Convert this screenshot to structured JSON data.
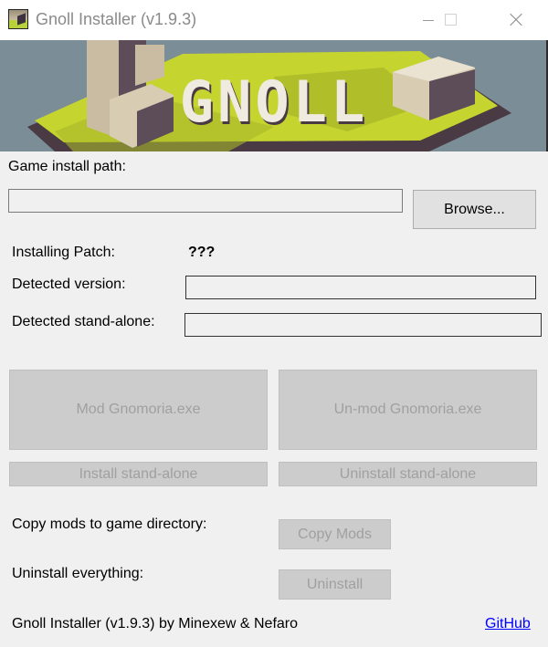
{
  "window": {
    "title": "Gnoll Installer (v1.9.3)",
    "icon": "gnoll-app-icon",
    "controls": [
      "minimize",
      "maximize",
      "close"
    ]
  },
  "banner": {
    "logo_text": "GNOLL",
    "colors": {
      "sky": "#7b8d96",
      "grass": "#c5d42f",
      "stone": "#c9bca2",
      "shadow": "#4a3a44",
      "logo": "#efebe0"
    }
  },
  "install_path": {
    "label": "Game install path:",
    "value": "",
    "browse_label": "Browse..."
  },
  "patch": {
    "label": "Installing Patch:",
    "value": "???"
  },
  "detected_version": {
    "label": "Detected version:",
    "value": ""
  },
  "detected_standalone": {
    "label": "Detected stand-alone:",
    "value": ""
  },
  "actions": {
    "mod_label": "Mod Gnomoria.exe",
    "unmod_label": "Un-mod Gnomoria.exe",
    "install_standalone_label": "Install stand-alone",
    "uninstall_standalone_label": "Uninstall stand-alone"
  },
  "copy_mods": {
    "label": "Copy mods to game directory:",
    "button_label": "Copy Mods"
  },
  "uninstall_all": {
    "label": "Uninstall everything:",
    "button_label": "Uninstall"
  },
  "footer": {
    "credits": "Gnoll Installer (v1.9.3) by Minexew & Nefaro",
    "link_label": "GitHub"
  }
}
